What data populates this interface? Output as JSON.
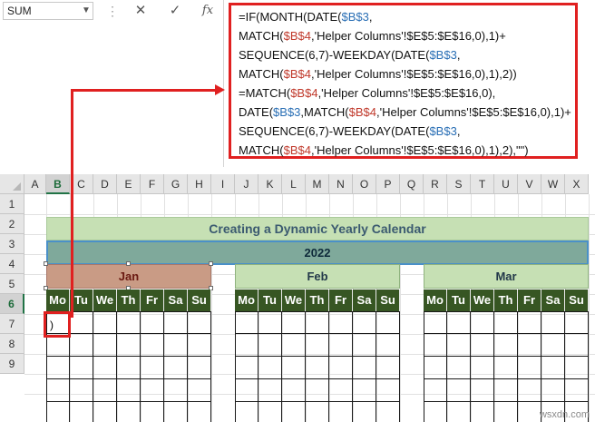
{
  "formula_bar": {
    "name_box": "SUM",
    "cancel_icon": "✕",
    "enter_icon": "✓",
    "fx_label": "fx",
    "formula_lines": [
      [
        {
          "t": "=IF(MONTH(DATE(",
          "c": "k"
        },
        {
          "t": "$B$3",
          "c": "b"
        },
        {
          "t": ",",
          "c": "k"
        }
      ],
      [
        {
          "t": "MATCH(",
          "c": "k"
        },
        {
          "t": "$B$4",
          "c": "r"
        },
        {
          "t": ",'Helper Columns'!$E$5:$E$16,0),1)+",
          "c": "k"
        }
      ],
      [
        {
          "t": "SEQUENCE(6,7)-WEEKDAY(DATE(",
          "c": "k"
        },
        {
          "t": "$B$3",
          "c": "b"
        },
        {
          "t": ",",
          "c": "k"
        }
      ],
      [
        {
          "t": "MATCH(",
          "c": "k"
        },
        {
          "t": "$B$4",
          "c": "r"
        },
        {
          "t": ",'Helper Columns'!$E$5:$E$16,0),1),2))",
          "c": "k"
        }
      ],
      [
        {
          "t": "=MATCH(",
          "c": "k"
        },
        {
          "t": "$B$4",
          "c": "r"
        },
        {
          "t": ",'Helper Columns'!$E$5:$E$16,0),",
          "c": "k"
        }
      ],
      [
        {
          "t": "DATE(",
          "c": "k"
        },
        {
          "t": "$B$3",
          "c": "b"
        },
        {
          "t": ",MATCH(",
          "c": "k"
        },
        {
          "t": "$B$4",
          "c": "r"
        },
        {
          "t": ",'Helper Columns'!$E$5:$E$16,0),1)+",
          "c": "k"
        }
      ],
      [
        {
          "t": "SEQUENCE(6,7)-WEEKDAY(DATE(",
          "c": "k"
        },
        {
          "t": "$B$3",
          "c": "b"
        },
        {
          "t": ",",
          "c": "k"
        }
      ],
      [
        {
          "t": "MATCH(",
          "c": "k"
        },
        {
          "t": "$B$4",
          "c": "r"
        },
        {
          "t": ",'Helper Columns'!$E$5:$E$16,0),1),2),\"\")",
          "c": "k"
        }
      ]
    ]
  },
  "grid": {
    "columns": [
      "A",
      "B",
      "C",
      "D",
      "E",
      "F",
      "G",
      "H",
      "I",
      "J",
      "K",
      "L",
      "M",
      "N",
      "O",
      "P",
      "Q",
      "R",
      "S",
      "T",
      "U",
      "V",
      "W",
      "X"
    ],
    "rows": [
      "1",
      "2",
      "3",
      "4",
      "5",
      "6",
      "7",
      "8",
      "9"
    ],
    "selected_column": "B",
    "selected_row": "6"
  },
  "calendar": {
    "title": "Creating a Dynamic  Yearly Calendar",
    "year": "2022",
    "months": [
      {
        "name": "Jan",
        "selected": true
      },
      {
        "name": "Feb",
        "selected": false
      },
      {
        "name": "Mar",
        "selected": false
      }
    ],
    "weekdays": [
      "Mo",
      "Tu",
      "We",
      "Th",
      "Fr",
      "Sa",
      "Su"
    ],
    "active_cell_text": ")"
  },
  "colors": {
    "title_band": "#c6e0b4",
    "year_band": "#7fa99b",
    "weekday_header": "#375623",
    "selected_month": "#c99b85",
    "callout": "#e02020"
  },
  "watermark": "wsxdn.com"
}
